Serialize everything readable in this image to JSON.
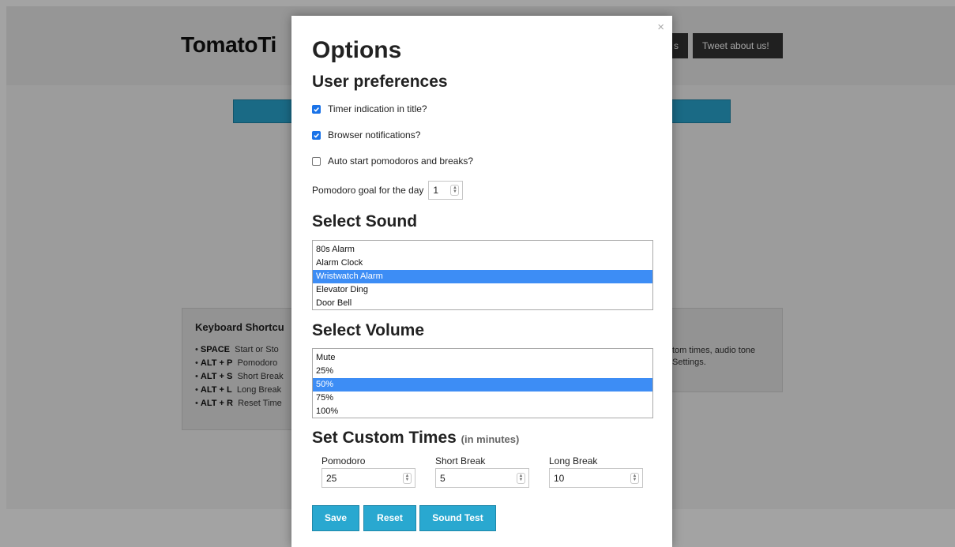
{
  "background": {
    "logo": "TomatoTi",
    "nav_buttons": [
      "s",
      "Tweet about us!"
    ],
    "keyboard": {
      "title": "Keyboard Shortcu",
      "items": [
        {
          "key": "SPACE",
          "label": "Start or Sto"
        },
        {
          "key": "ALT + P",
          "label": "Pomodoro"
        },
        {
          "key": "ALT + S",
          "label": "Short Break"
        },
        {
          "key": "ALT + L",
          "label": "Long Break"
        },
        {
          "key": "ALT + R",
          "label": "Reset Time"
        }
      ]
    },
    "right_panel": {
      "line1": "tom times, audio tone",
      "line2": "Settings."
    }
  },
  "modal": {
    "close": "×",
    "title": "Options",
    "preferences": {
      "title": "User preferences",
      "items": [
        {
          "label": "Timer indication in title?",
          "checked": true
        },
        {
          "label": "Browser notifications?",
          "checked": true
        },
        {
          "label": "Auto start pomodoros and breaks?",
          "checked": false
        }
      ],
      "goal_label": "Pomodoro goal for the day",
      "goal_value": "1"
    },
    "sound": {
      "title": "Select Sound",
      "options": [
        "80s Alarm",
        "Alarm Clock",
        "Wristwatch Alarm",
        "Elevator Ding",
        "Door Bell"
      ],
      "selected": "Wristwatch Alarm"
    },
    "volume": {
      "title": "Select Volume",
      "options": [
        "Mute",
        "25%",
        "50%",
        "75%",
        "100%"
      ],
      "selected": "50%"
    },
    "custom_times": {
      "title": "Set Custom Times",
      "note": "(in minutes)",
      "fields": [
        {
          "label": "Pomodoro",
          "value": "25"
        },
        {
          "label": "Short Break",
          "value": "5"
        },
        {
          "label": "Long Break",
          "value": "10"
        }
      ]
    },
    "buttons": {
      "save": "Save",
      "reset": "Reset",
      "sound_test": "Sound Test"
    }
  },
  "colors": {
    "accent": "#29a8d0",
    "checkbox": "#1a73e8",
    "selected_option": "#3d8df5"
  }
}
